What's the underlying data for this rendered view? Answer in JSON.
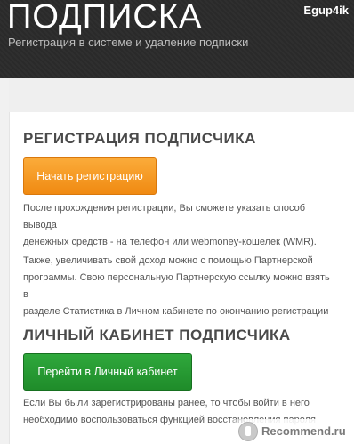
{
  "header": {
    "title": "ПОДПИСКА",
    "subtitle": "Регистрация в системе и удаление подписки",
    "watermark": "Egup4ik"
  },
  "registration": {
    "heading": "РЕГИСТРАЦИЯ ПОДПИСЧИКА",
    "button_label": "Начать регистрацию",
    "para1_line1": "После прохождения регистрации, Вы сможете указать способ вывода",
    "para1_line2": "денежных средств - на телефон или webmoney-кошелек (WMR).",
    "para2_line1": "Также, увеличивать свой доход можно с помощью Партнерской",
    "para2_line2": "программы. Свою персональную Партнерскую ссылку можно взять в",
    "para2_line3": "разделе Статистика в Личном кабинете по окончанию регистрации"
  },
  "cabinet": {
    "heading": "ЛИЧНЫЙ КАБИНЕТ ПОДПИСЧИКА",
    "button_label": "Перейти в Личный кабинет",
    "para_line1": "Если Вы были зарегистрированы ранее, то чтобы войти в него",
    "para_line2": "необходимо воспользоваться функцией восстановления пароля"
  },
  "bottom_watermark": "Recommend.ru",
  "colors": {
    "header_bg": "#2b2b2b",
    "orange_button": "#f59a22",
    "green_button": "#27983a",
    "heading_text": "#4a4a4a"
  }
}
